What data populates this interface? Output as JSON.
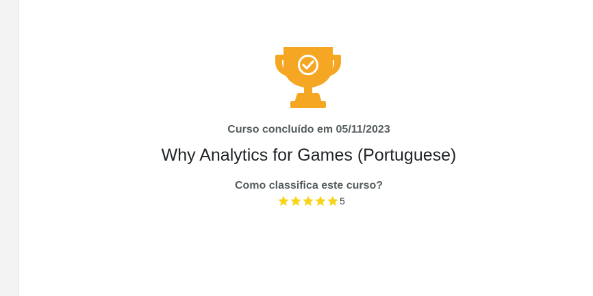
{
  "completion": {
    "label": "Curso concluído em 05/11/2023",
    "icon": "trophy-check-icon",
    "trophy_color": "#f5a623"
  },
  "course": {
    "title": "Why Analytics for Games (Portuguese)"
  },
  "rating": {
    "question": "Como classifica este curso?",
    "stars": 5,
    "max_stars": 5,
    "value_label": "5",
    "star_color": "#f7d41c"
  }
}
